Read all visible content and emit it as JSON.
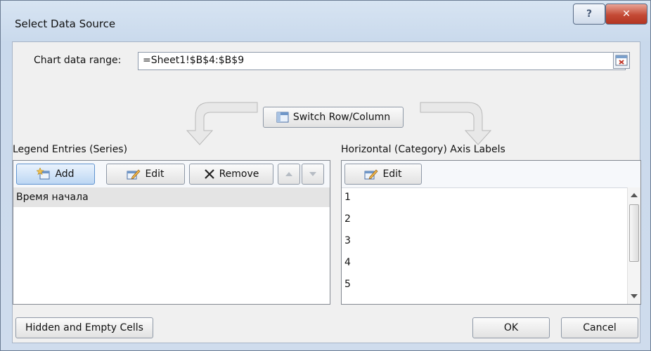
{
  "window": {
    "title": "Select Data Source",
    "help_label": "?",
    "close_label": "✕"
  },
  "range": {
    "label": "Chart data range:",
    "value": "=Sheet1!$B$4:$B$9"
  },
  "switch_button": {
    "label": "Switch Row/Column"
  },
  "legend": {
    "heading": "Legend Entries (Series)",
    "add_label": "Add",
    "edit_label": "Edit",
    "remove_label": "Remove",
    "entries": [
      "Время начала"
    ]
  },
  "axis": {
    "heading": "Horizontal (Category) Axis Labels",
    "edit_label": "Edit",
    "labels": [
      "1",
      "2",
      "3",
      "4",
      "5"
    ]
  },
  "footer": {
    "hidden_cells_label": "Hidden and Empty Cells",
    "ok_label": "OK",
    "cancel_label": "Cancel"
  },
  "icons": [
    "add-icon",
    "edit-icon",
    "remove-icon",
    "move-up-icon",
    "move-down-icon",
    "switch-icon",
    "range-collapse-icon"
  ]
}
